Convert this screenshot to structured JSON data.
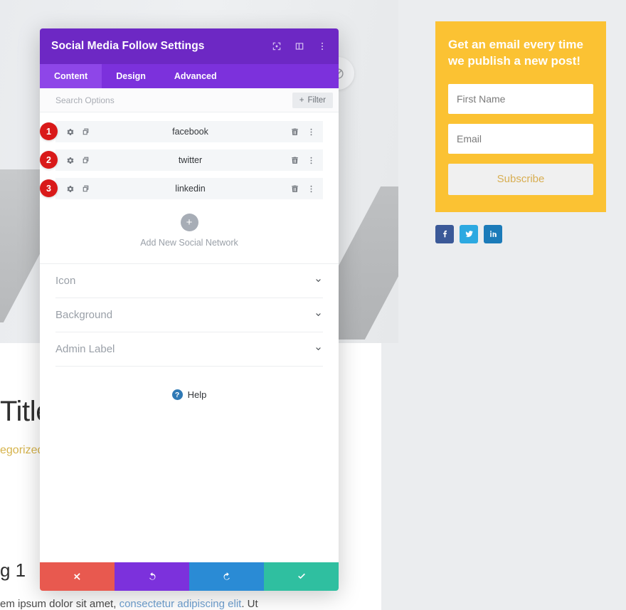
{
  "background": {
    "title": "Title",
    "category": "egorized",
    "heading": "g 1",
    "paragraph_prefix": "em ipsum dolor sit amet, ",
    "paragraph_link": "consectetur adipiscing elit",
    "paragraph_suffix": ". Ut"
  },
  "sidebar": {
    "optin": {
      "title": "Get an email every time we publish a new post!",
      "first_name_placeholder": "First Name",
      "first_name_value": "",
      "email_placeholder": "Email",
      "email_value": "",
      "subscribe_label": "Subscribe",
      "bg_color": "#fbc233",
      "button_text_color": "#d8ae52"
    },
    "social": [
      {
        "name": "facebook",
        "icon": "facebook-icon",
        "color": "#3b5998"
      },
      {
        "name": "twitter",
        "icon": "twitter-icon",
        "color": "#2ca9e1"
      },
      {
        "name": "linkedin",
        "icon": "linkedin-icon",
        "color": "#1b7bb9"
      }
    ]
  },
  "modal": {
    "title": "Social Media Follow Settings",
    "header_icons": [
      {
        "name": "focus-icon"
      },
      {
        "name": "layout-split-icon"
      },
      {
        "name": "more-vertical-icon"
      }
    ],
    "tabs": [
      {
        "label": "Content",
        "active": true
      },
      {
        "label": "Design",
        "active": false
      },
      {
        "label": "Advanced",
        "active": false
      }
    ],
    "search": {
      "placeholder": "Search Options",
      "value": "",
      "filter_label": "Filter"
    },
    "networks": [
      {
        "badge": "1",
        "label": "facebook"
      },
      {
        "badge": "2",
        "label": "twitter"
      },
      {
        "badge": "3",
        "label": "linkedin"
      }
    ],
    "add_new_label": "Add New Social Network",
    "accordions": [
      {
        "label": "Icon"
      },
      {
        "label": "Background"
      },
      {
        "label": "Admin Label"
      }
    ],
    "help_label": "Help",
    "footer_buttons": [
      {
        "name": "cancel-button",
        "icon": "close-icon",
        "color": "#e8594f"
      },
      {
        "name": "undo-button",
        "icon": "undo-icon",
        "color": "#7c31dc"
      },
      {
        "name": "redo-button",
        "icon": "redo-icon",
        "color": "#2a8bd5"
      },
      {
        "name": "save-button",
        "icon": "check-icon",
        "color": "#2fbfa0"
      }
    ],
    "colors": {
      "header": "#6d28c4",
      "tabbar": "#7c31dc",
      "tab_active": "#8e46e8",
      "badge": "#d91919"
    }
  }
}
